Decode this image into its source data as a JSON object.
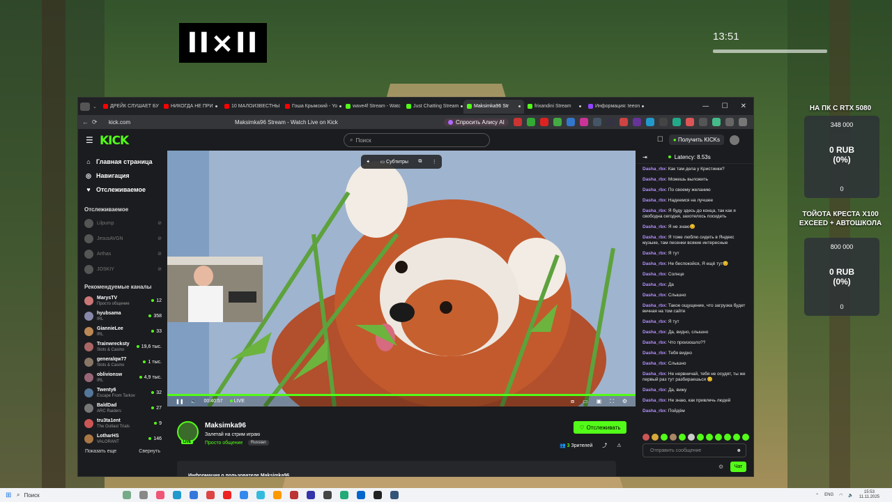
{
  "overlay": {
    "logo_text": "II×II",
    "clock": "13:51",
    "goals": [
      {
        "title": "НА ПК С RTX 5080",
        "target": "348 000",
        "amount": "0 RUB",
        "percent": "(0%)",
        "progress": "0"
      },
      {
        "title": "ТОЙОТА КРЕСТА X100 EXCEED + АВТОШКОЛА",
        "target": "800 000",
        "amount": "0 RUB",
        "percent": "(0%)",
        "progress": "0"
      }
    ]
  },
  "browser": {
    "tabs": [
      {
        "title": "ДРЕЙК СЛУШАЕТ БУ",
        "icon": "youtube-icon",
        "color": "#ff0000"
      },
      {
        "title": "НИКОГДА НЕ ПРИ",
        "icon": "youtube-icon",
        "color": "#ff0000"
      },
      {
        "title": "10 МАЛОИЗВЕСТНЫ",
        "icon": "youtube-icon",
        "color": "#ff0000"
      },
      {
        "title": "Гоша Крымский - Yo",
        "icon": "youtube-icon",
        "color": "#ff0000"
      },
      {
        "title": "wave4f Stream - Watc",
        "icon": "kick-icon",
        "color": "#53fc18"
      },
      {
        "title": "Just Chatting Stream",
        "icon": "kick-icon",
        "color": "#53fc18"
      },
      {
        "title": "Maksimka96 Str",
        "icon": "kick-icon",
        "color": "#53fc18",
        "active": true
      },
      {
        "title": "frixandini Stream",
        "icon": "kick-icon",
        "color": "#53fc18"
      },
      {
        "title": "Информация: teeon",
        "icon": "twitch-icon",
        "color": "#9146ff"
      }
    ],
    "url": "kick.com",
    "page_title": "Maksimka96 Stream - Watch Live on Kick",
    "alice_label": "Спросить Алису AI"
  },
  "kick": {
    "logo": "KICK",
    "search_placeholder": "Поиск",
    "get_kicks": "Получить KICKs",
    "nav": [
      {
        "label": "Главная страница",
        "icon": "home-icon"
      },
      {
        "label": "Навигация",
        "icon": "compass-icon"
      },
      {
        "label": "Отслеживаемое",
        "icon": "heart-icon"
      }
    ],
    "following_title": "Отслеживаемое",
    "following": [
      "Lilpump",
      "JesusAVGN",
      "Arthas",
      "JOSKIY"
    ],
    "recommended_title": "Рекомендуемые каналы",
    "recommended": [
      {
        "name": "MarysTV",
        "category": "Просто общение",
        "viewers": "12",
        "color": "#c77"
      },
      {
        "name": "hyubsama",
        "category": "IRL",
        "viewers": "358",
        "color": "#88a"
      },
      {
        "name": "GiannieLee",
        "category": "IRL",
        "viewers": "33",
        "color": "#b85"
      },
      {
        "name": "Trainwrecksty",
        "category": "Slots & Casino",
        "viewers": "19,6 тыс.",
        "color": "#a66"
      },
      {
        "name": "generalqw77",
        "category": "Slots & Casino",
        "viewers": "1 тыс.",
        "color": "#876"
      },
      {
        "name": "oblivionsw",
        "category": "IRL",
        "viewers": "4,9 тыс.",
        "color": "#967"
      },
      {
        "name": "Twenty6",
        "category": "Escape From Tarkov",
        "viewers": "32",
        "color": "#579"
      },
      {
        "name": "BaldDad",
        "category": "ARC Raiders",
        "viewers": "27",
        "color": "#777"
      },
      {
        "name": "tru3ta1ent",
        "category": "The Outlast Trials",
        "viewers": "9",
        "color": "#c55"
      },
      {
        "name": "LotharHS",
        "category": "VALORANT",
        "viewers": "146",
        "color": "#a74"
      }
    ],
    "show_more": "Показать еще",
    "collapse": "Свернуть"
  },
  "player": {
    "subtitles": "Субтитры",
    "time": "00:40:57",
    "live": "LIVE"
  },
  "stream": {
    "name": "Maksimka96",
    "title": "Залетай на стрим играю",
    "category": "Просто общение",
    "language": "Russian",
    "live_badge": "LIVE",
    "follow": "Отслеживать",
    "viewers_count": "3",
    "viewers_label": "Зрителей",
    "about": "Информация о пользователе Maksimka96"
  },
  "chat": {
    "latency": "Latency: 8.53s",
    "messages": [
      {
        "user": "Dasha_rbx",
        "text": "Как там дела у Кристинки?"
      },
      {
        "user": "Dasha_rbx",
        "text": "Можешь выложить"
      },
      {
        "user": "Dasha_rbx",
        "text": "По своему желанию"
      },
      {
        "user": "Dasha_rbx",
        "text": "Надеемся на лучшее"
      },
      {
        "user": "Dasha_rbx",
        "text": "Я буду здесь до конца, так как я свободна сегодня, захотелось посидеть"
      },
      {
        "user": "Dasha_rbx",
        "text": "Я не знаю😊"
      },
      {
        "user": "Dasha_rbx",
        "text": "Я тоже люблю сидеть в Яндекс музыке, там песенки всякие интересные"
      },
      {
        "user": "Dasha_rbx",
        "text": "Я тут"
      },
      {
        "user": "Dasha_rbx",
        "text": "Не беспокойся, Я ещё тут😊"
      },
      {
        "user": "Dasha_rbx",
        "text": "Солнце"
      },
      {
        "user": "Dasha_rbx",
        "text": "Да"
      },
      {
        "user": "Dasha_rbx",
        "text": "Слышно"
      },
      {
        "user": "Dasha_rbx",
        "text": "Такое ощущение, что загрузка будет вечная на том сайте"
      },
      {
        "user": "Dasha_rbx",
        "text": "Я тут"
      },
      {
        "user": "Dasha_rbx",
        "text": "Да, видно, слышно"
      },
      {
        "user": "Dasha_rbx",
        "text": "Что произошло??"
      },
      {
        "user": "Dasha_rbx",
        "text": "Тебя видно"
      },
      {
        "user": "Dasha_rbx",
        "text": "Слышно"
      },
      {
        "user": "Dasha_rbx",
        "text": "Не нервничай, тебя не осудят, ты же первый раз тут разбираешься 😊"
      },
      {
        "user": "Dasha_rbx",
        "text": "Да, вижу"
      },
      {
        "user": "Dasha_rbx",
        "text": "Не знаю, как привлечь людей"
      },
      {
        "user": "Dasha_rbx",
        "text": "Пойдём"
      }
    ],
    "input_placeholder": "Отправить сообщение",
    "send": "Чат"
  },
  "taskbar": {
    "search": "Поиск",
    "lang": "ENG",
    "time": "15:53",
    "date": "11.11.2025"
  }
}
